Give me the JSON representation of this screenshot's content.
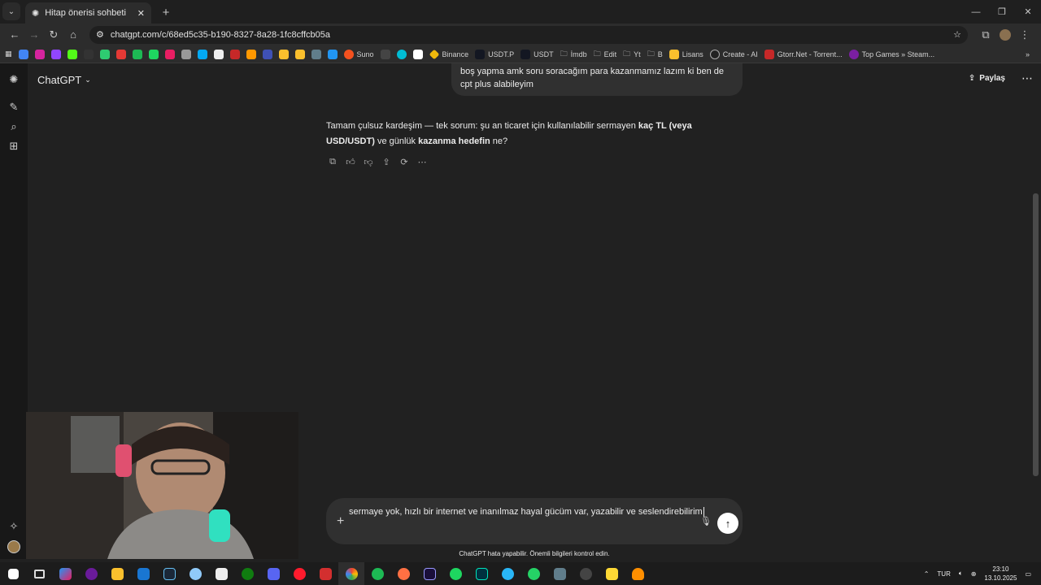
{
  "browser": {
    "tab_title": "Hitap önerisi sohbeti",
    "url": "chatgpt.com/c/68ed5c35-b190-8327-8a28-1fc8cffcb05a",
    "bookmarks": [
      "Suno",
      "Binance",
      "USDT.P",
      "USDT",
      "İmdb",
      "Edit",
      "Yt",
      "B",
      "Lisans",
      "Create - AI",
      "Gtorr.Net - Torrent...",
      "Top Games » Steam..."
    ]
  },
  "app": {
    "brand": "ChatGPT",
    "share_label": "Paylaş"
  },
  "chat": {
    "user_message": "boş yapma amk soru soracağım para kazanmamız lazım ki ben de cpt plus alabileyim",
    "assistant": {
      "part1": "Tamam çulsuz kardeşim — tek sorum: şu an ticaret için kullanılabilir sermayen ",
      "bold1": "kaç TL (veya USD/USDT)",
      "part2": " ve günlük ",
      "bold2": "kazanma hedefin",
      "part3": " ne?"
    }
  },
  "composer": {
    "text": "sermaye yok, hızlı bir internet ve inanılmaz hayal gücüm var, yazabilir ve seslendirebilirim"
  },
  "disclaimer": "ChatGPT hata yapabilir. Önemli bilgileri kontrol edin.",
  "tray": {
    "lang": "TUR",
    "time": "23:10",
    "date": "13.10.2025"
  }
}
